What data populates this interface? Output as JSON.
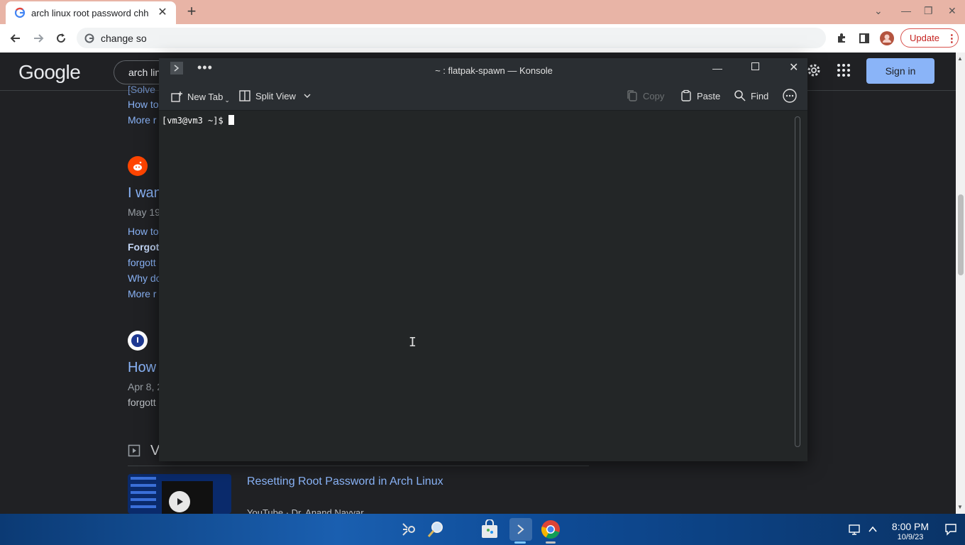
{
  "browser": {
    "tab_title": "arch linux root password chh",
    "address": "change so",
    "update_label": "Update",
    "update_menu": "⋮"
  },
  "google": {
    "logo": "Google",
    "search_value": "arch lin",
    "signin_label": "Sign in",
    "result1": {
      "line_top": "[Solve",
      "link1": "How to",
      "more": "More r"
    },
    "result2": {
      "title": "I wan",
      "date": "May 19",
      "link1": "How to",
      "link2": "Forgot",
      "link3": "forgott",
      "link4": "Why do",
      "more": "More r"
    },
    "result3": {
      "title": "How",
      "date": "Apr 8, 2",
      "snippet": "forgott"
    },
    "videos_heading": "V",
    "video": {
      "title": "Resetting Root Password in Arch Linux",
      "source": "YouTube · Dr. Anand Nayyar"
    }
  },
  "konsole": {
    "title": "~ : flatpak-spawn — Konsole",
    "new_tab": "New Tab",
    "split_view": "Split View",
    "copy": "Copy",
    "paste": "Paste",
    "find": "Find",
    "prompt": "[vm3@vm3 ~]$ "
  },
  "taskbar": {
    "time": "8:00 PM",
    "date": "10/9/23"
  },
  "colors": {
    "tabbar": "#e8b4a6",
    "google_bg": "#202124",
    "link": "#8ab4f8",
    "konsole_bg": "#232627",
    "update_red": "#c5221f"
  }
}
